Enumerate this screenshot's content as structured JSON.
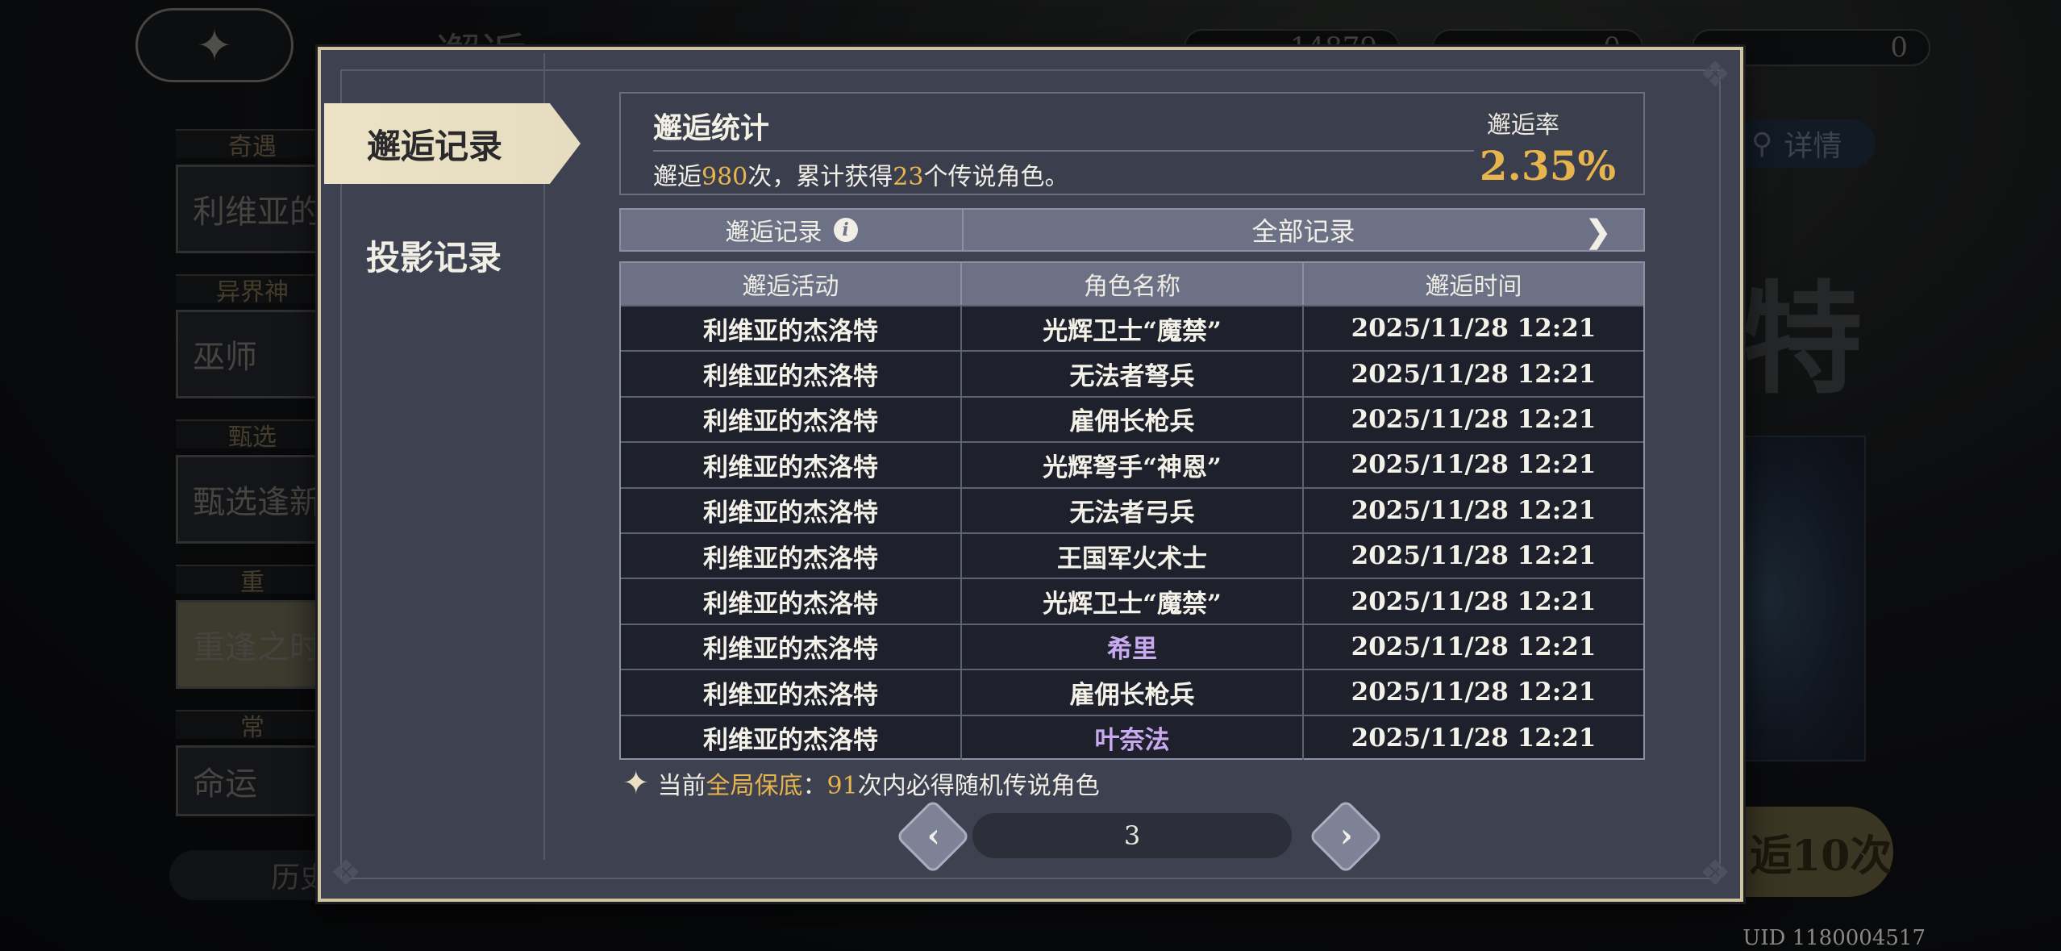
{
  "background": {
    "back_glyph": "✦",
    "title_fragment": "邂逅",
    "currency_a": "14879",
    "currency_b": "0",
    "currency_c": "0",
    "cards": [
      {
        "label": "奇遇",
        "name": "利维亚的杰洛特"
      },
      {
        "label": "异界神",
        "name": "巫师"
      },
      {
        "label": "甄选",
        "name": "甄选逢新"
      },
      {
        "label": "重",
        "name": "重逢之时"
      },
      {
        "label": "常",
        "name": "命运"
      }
    ],
    "history_fragment": "历史",
    "detail_label": "详情",
    "big_name_fragment": "特",
    "pull_fragment": "逅10次",
    "uid": "UID 1180004517"
  },
  "sidebar": {
    "tabs": [
      {
        "label": "邂逅记录",
        "active": true
      },
      {
        "label": "投影记录",
        "active": false
      }
    ]
  },
  "stats": {
    "title": "邂逅统计",
    "text_prefix": "邂逅",
    "count": "980",
    "text_mid": "次，累计获得",
    "legend_count": "23",
    "text_suffix": "个传说角色。",
    "rate_label": "邂逅率",
    "rate_value": "2.35%"
  },
  "filter": {
    "label": "邂逅记录",
    "selected": "全部记录"
  },
  "table": {
    "headers": [
      "邂逅活动",
      "角色名称",
      "邂逅时间"
    ],
    "rows": [
      {
        "activity": "利维亚的杰洛特",
        "character": "光辉卫士“魔禁”",
        "time": "2025/11/28 12:21",
        "rarity": "normal"
      },
      {
        "activity": "利维亚的杰洛特",
        "character": "无法者弩兵",
        "time": "2025/11/28 12:21",
        "rarity": "normal"
      },
      {
        "activity": "利维亚的杰洛特",
        "character": "雇佣长枪兵",
        "time": "2025/11/28 12:21",
        "rarity": "normal"
      },
      {
        "activity": "利维亚的杰洛特",
        "character": "光辉弩手“神恩”",
        "time": "2025/11/28 12:21",
        "rarity": "normal"
      },
      {
        "activity": "利维亚的杰洛特",
        "character": "无法者弓兵",
        "time": "2025/11/28 12:21",
        "rarity": "normal"
      },
      {
        "activity": "利维亚的杰洛特",
        "character": "王国军火术士",
        "time": "2025/11/28 12:21",
        "rarity": "normal"
      },
      {
        "activity": "利维亚的杰洛特",
        "character": "光辉卫士“魔禁”",
        "time": "2025/11/28 12:21",
        "rarity": "normal"
      },
      {
        "activity": "利维亚的杰洛特",
        "character": "希里",
        "time": "2025/11/28 12:21",
        "rarity": "epic"
      },
      {
        "activity": "利维亚的杰洛特",
        "character": "雇佣长枪兵",
        "time": "2025/11/28 12:21",
        "rarity": "normal"
      },
      {
        "activity": "利维亚的杰洛特",
        "character": "叶奈法",
        "time": "2025/11/28 12:21",
        "rarity": "epic"
      }
    ]
  },
  "pity": {
    "prefix": "当前",
    "highlight": "全局保底",
    "colon": "：",
    "count": "91",
    "suffix": "次内必得随机传说角色"
  },
  "pagination": {
    "page": "3",
    "prev_glyph": "‹",
    "next_glyph": "›"
  },
  "colors": {
    "accent_gold": "#e8b44d",
    "epic_text": "#c9a9f0",
    "frame": "#cfc3a0",
    "panel": "#3d4150"
  },
  "icons": {
    "info": "i",
    "chevron": "❯",
    "star": "✦",
    "search": "⚲"
  }
}
